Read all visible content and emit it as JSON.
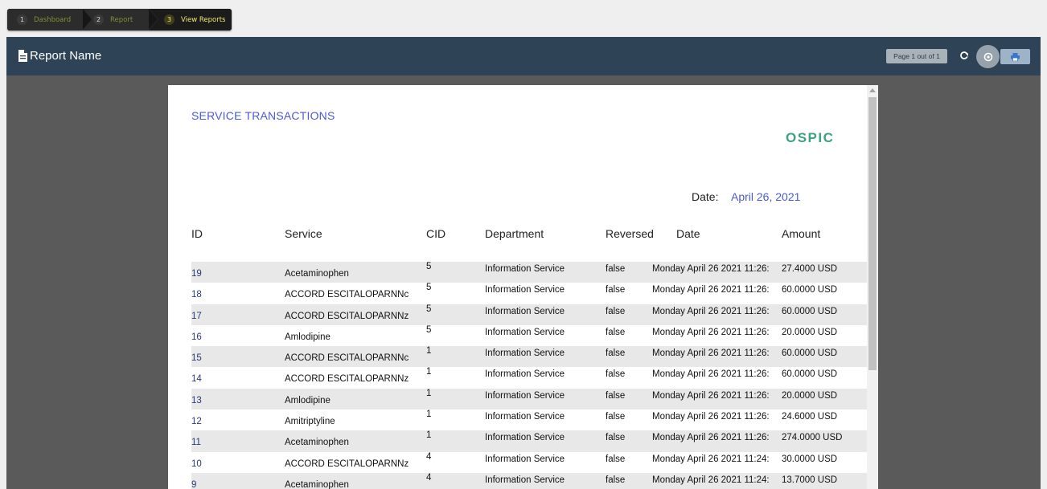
{
  "breadcrumb": [
    {
      "num": "1",
      "label": "Dashboard"
    },
    {
      "num": "2",
      "label": "Report"
    },
    {
      "num": "3",
      "label": "View Reports"
    }
  ],
  "header": {
    "title": "Report Name",
    "page_indicator": "Page 1 out of 1",
    "icons": [
      "document-icon",
      "refresh-icon",
      "settings-icon",
      "print-icon"
    ]
  },
  "report": {
    "title": "SERVICE TRANSACTIONS",
    "logo": "OSPIC",
    "date_label": "Date:",
    "date_value": "April 26, 2021",
    "columns": [
      "ID",
      "Service",
      "CID",
      "Department",
      "Reversed",
      "Date",
      "Amount"
    ],
    "rows": [
      {
        "id": "19",
        "service": "Acetaminophen",
        "cid": "5",
        "department": "Information Service",
        "reversed": "false",
        "date": "Monday April 26 2021 11:26:",
        "amount": "27.4000 USD"
      },
      {
        "id": "18",
        "service": "ACCORD ESCITALOPARNNc",
        "cid": "5",
        "department": "Information Service",
        "reversed": "false",
        "date": "Monday April 26 2021 11:26:",
        "amount": "60.0000 USD"
      },
      {
        "id": "17",
        "service": "ACCORD ESCITALOPARNNz",
        "cid": "5",
        "department": "Information Service",
        "reversed": "false",
        "date": "Monday April 26 2021 11:26:",
        "amount": "60.0000 USD"
      },
      {
        "id": "16",
        "service": "Amlodipine",
        "cid": "5",
        "department": "Information Service",
        "reversed": "false",
        "date": "Monday April 26 2021 11:26:",
        "amount": "20.0000 USD"
      },
      {
        "id": "15",
        "service": "ACCORD ESCITALOPARNNc",
        "cid": "1",
        "department": "Information Service",
        "reversed": "false",
        "date": "Monday April 26 2021 11:26:",
        "amount": "60.0000 USD"
      },
      {
        "id": "14",
        "service": "ACCORD ESCITALOPARNNz",
        "cid": "1",
        "department": "Information Service",
        "reversed": "false",
        "date": "Monday April 26 2021 11:26:",
        "amount": "60.0000 USD"
      },
      {
        "id": "13",
        "service": "Amlodipine",
        "cid": "1",
        "department": "Information Service",
        "reversed": "false",
        "date": "Monday April 26 2021 11:26:",
        "amount": "20.0000 USD"
      },
      {
        "id": "12",
        "service": "Amitriptyline",
        "cid": "1",
        "department": "Information Service",
        "reversed": "false",
        "date": "Monday April 26 2021 11:26:",
        "amount": "24.6000 USD"
      },
      {
        "id": "11",
        "service": "Acetaminophen",
        "cid": "1",
        "department": "Information Service",
        "reversed": "false",
        "date": "Monday April 26 2021 11:26:",
        "amount": "274.0000 USD"
      },
      {
        "id": "10",
        "service": "ACCORD ESCITALOPARNNz",
        "cid": "4",
        "department": "Information Service",
        "reversed": "false",
        "date": "Monday April 26 2021 11:24:",
        "amount": "30.0000 USD"
      },
      {
        "id": "9",
        "service": "Acetaminophen",
        "cid": "4",
        "department": "Information Service",
        "reversed": "false",
        "date": "Monday April 26 2021 11:24:",
        "amount": "13.7000 USD"
      }
    ]
  },
  "colors": {
    "header_bg": "#2e4356",
    "accent_blue": "#4a5bd3",
    "logo_green": "#3aa37f",
    "breadcrumb_active": "#f1e96a",
    "breadcrumb_inactive": "#7f8f3a"
  }
}
